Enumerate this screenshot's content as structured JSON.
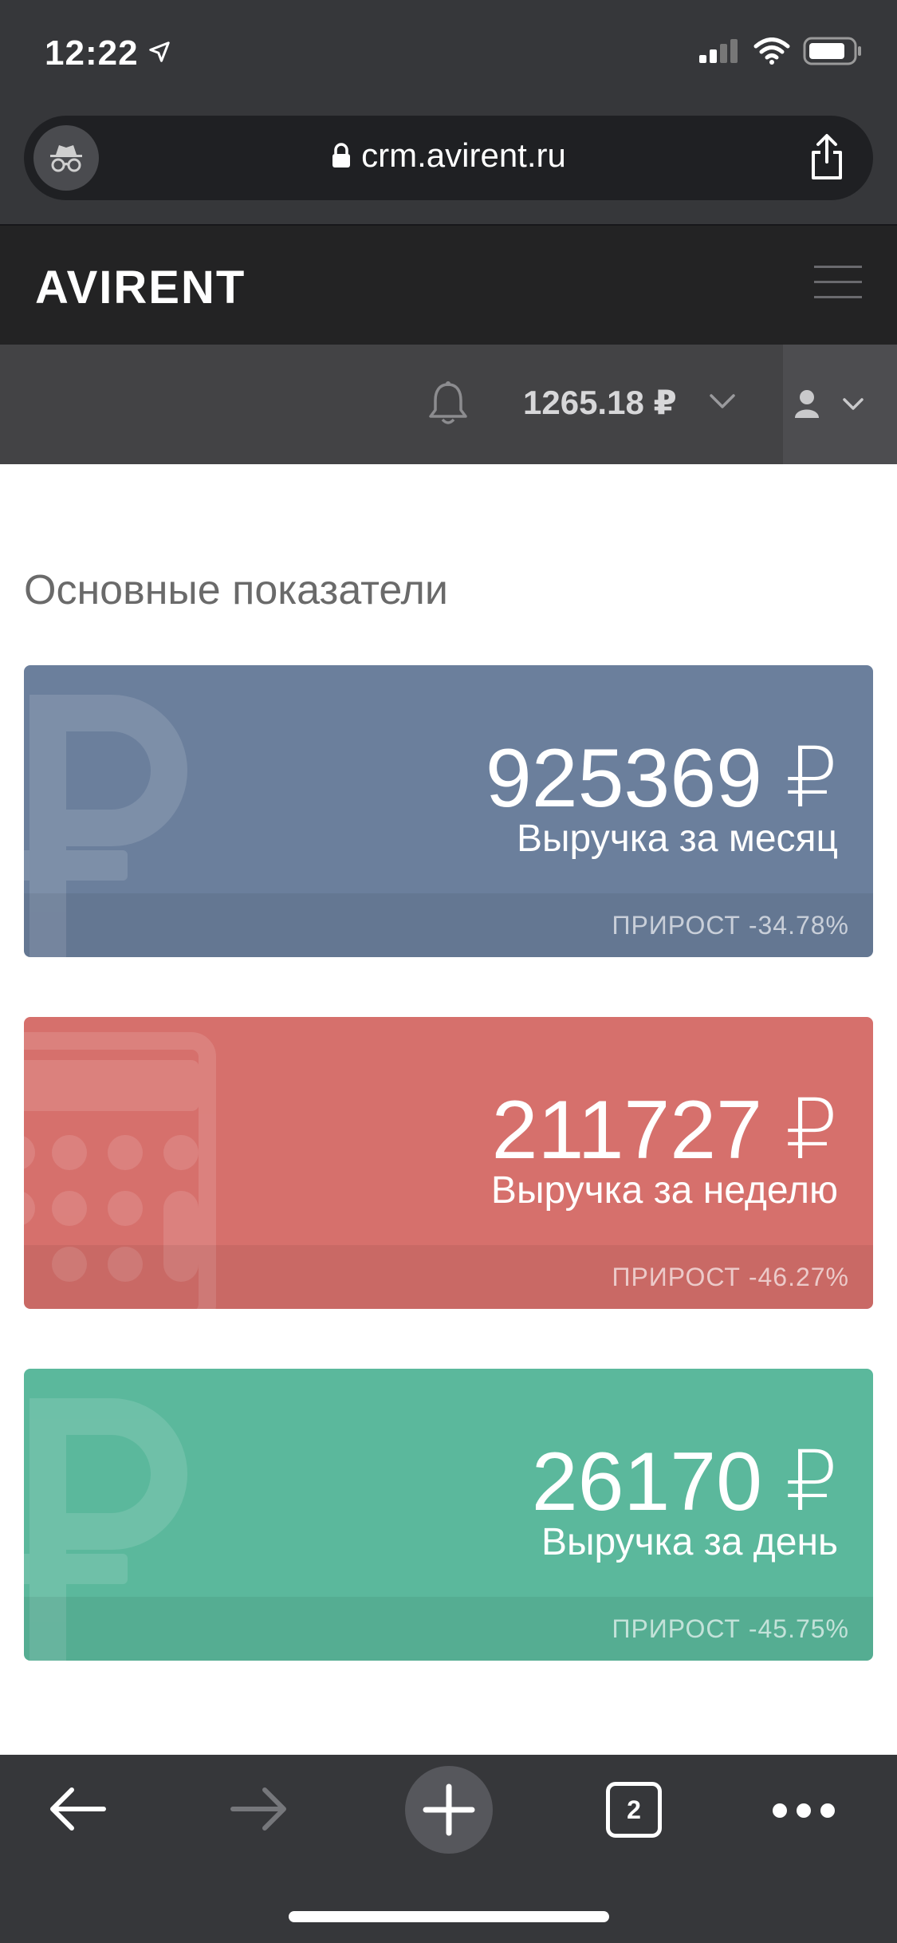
{
  "status_bar": {
    "time": "12:22"
  },
  "browser": {
    "url": "crm.avirent.ru"
  },
  "header": {
    "logo": "AVIRENT"
  },
  "toolbar": {
    "balance": "1265.18 ₽"
  },
  "main": {
    "title": "Основные показатели",
    "cards": [
      {
        "value": "925369 ₽",
        "label": "Выручка за месяц",
        "growth": "ПРИРОСТ -34.78%",
        "color": "#6b7f9c",
        "icon": "ruble-icon"
      },
      {
        "value": "211727 ₽",
        "label": "Выручка за неделю",
        "growth": "ПРИРОСТ -46.27%",
        "color": "#d6706c",
        "icon": "calculator-icon"
      },
      {
        "value": "26170 ₽",
        "label": "Выручка за день",
        "growth": "ПРИРОСТ -45.75%",
        "color": "#5bb89c",
        "icon": "ruble-icon"
      }
    ]
  },
  "bottom_bar": {
    "tabs_count": "2"
  }
}
